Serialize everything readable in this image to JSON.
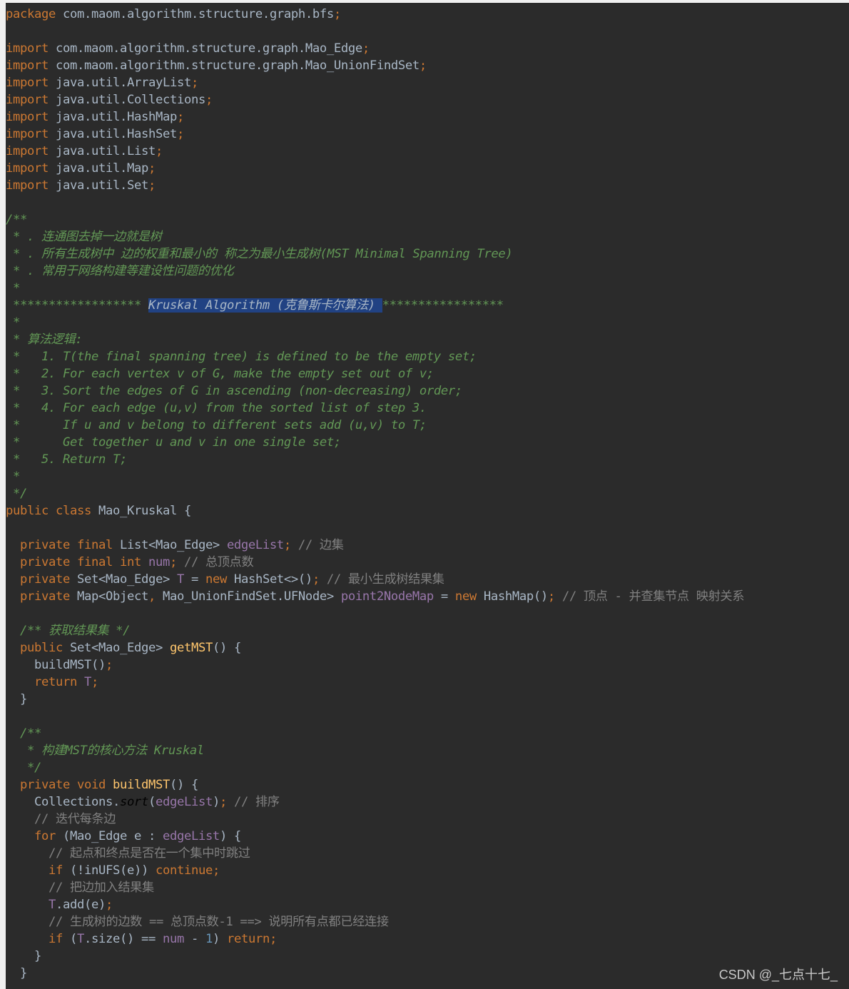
{
  "editor": {
    "background": "#2b2b2b",
    "selection_color": "#214283",
    "colors": {
      "keyword": "#cc7832",
      "plain": "#a9b7c6",
      "doc_comment": "#629755",
      "line_comment": "#808080",
      "field": "#9876aa",
      "method": "#ffc66d",
      "number": "#6897bb"
    }
  },
  "lines": [
    [
      [
        "kw",
        "package"
      ],
      [
        "pl",
        " com.maom.algorithm.structure.graph.bfs"
      ],
      [
        "kw",
        ";"
      ]
    ],
    [],
    [
      [
        "kw",
        "import"
      ],
      [
        "pl",
        " com.maom.algorithm.structure.graph.Mao_Edge"
      ],
      [
        "kw",
        ";"
      ]
    ],
    [
      [
        "kw",
        "import"
      ],
      [
        "pl",
        " com.maom.algorithm.structure.graph.Mao_UnionFindSet"
      ],
      [
        "kw",
        ";"
      ]
    ],
    [
      [
        "kw",
        "import"
      ],
      [
        "pl",
        " java.util.ArrayList"
      ],
      [
        "kw",
        ";"
      ]
    ],
    [
      [
        "kw",
        "import"
      ],
      [
        "pl",
        " java.util.Collections"
      ],
      [
        "kw",
        ";"
      ]
    ],
    [
      [
        "kw",
        "import"
      ],
      [
        "pl",
        " java.util.HashMap"
      ],
      [
        "kw",
        ";"
      ]
    ],
    [
      [
        "kw",
        "import"
      ],
      [
        "pl",
        " java.util.HashSet"
      ],
      [
        "kw",
        ";"
      ]
    ],
    [
      [
        "kw",
        "import"
      ],
      [
        "pl",
        " java.util.List"
      ],
      [
        "kw",
        ";"
      ]
    ],
    [
      [
        "kw",
        "import"
      ],
      [
        "pl",
        " java.util.Map"
      ],
      [
        "kw",
        ";"
      ]
    ],
    [
      [
        "kw",
        "import"
      ],
      [
        "pl",
        " java.util.Set"
      ],
      [
        "kw",
        ";"
      ]
    ],
    [],
    [
      [
        "cm",
        "/**"
      ]
    ],
    [
      [
        "cm",
        " * . 连通图去掉一边就是树"
      ]
    ],
    [
      [
        "cm",
        " * . 所有生成树中 边的权重和最小的 称之为最小生成树(MST Minimal Spanning Tree)"
      ]
    ],
    [
      [
        "cm",
        " * . 常用于网络构建等建设性问题的优化"
      ]
    ],
    [
      [
        "cm",
        " *"
      ]
    ],
    [
      [
        "cm",
        " ****************** "
      ],
      [
        "hl",
        "Kruskal Algorithm (克鲁斯卡尔算法) "
      ],
      [
        "cm",
        "*****************"
      ]
    ],
    [
      [
        "cm",
        " *"
      ]
    ],
    [
      [
        "cm",
        " * 算法逻辑:"
      ]
    ],
    [
      [
        "cm",
        " *   1. T(the final spanning tree) is defined to be the empty set;"
      ]
    ],
    [
      [
        "cm",
        " *   2. For each vertex v of G, make the empty set out of v;"
      ]
    ],
    [
      [
        "cm",
        " *   3. Sort the edges of G in ascending (non-decreasing) order;"
      ]
    ],
    [
      [
        "cm",
        " *   4. For each edge (u,v) from the sorted list of step 3."
      ]
    ],
    [
      [
        "cm",
        " *      If u and v belong to different sets add (u,v) to T;"
      ]
    ],
    [
      [
        "cm",
        " *      Get together u and v in one single set;"
      ]
    ],
    [
      [
        "cm",
        " *   5. Return T;"
      ]
    ],
    [
      [
        "cm",
        " *"
      ]
    ],
    [
      [
        "cm",
        " */"
      ]
    ],
    [
      [
        "kw",
        "public class"
      ],
      [
        "pl",
        " Mao_Kruskal {"
      ]
    ],
    [],
    [
      [
        "kw",
        "  private final"
      ],
      [
        "pl",
        " List<Mao_Edge> "
      ],
      [
        "fd",
        "edgeList"
      ],
      [
        "kw",
        ";"
      ],
      [
        "lc",
        " // 边集"
      ]
    ],
    [
      [
        "kw",
        "  private final int"
      ],
      [
        "fd",
        " num"
      ],
      [
        "kw",
        ";"
      ],
      [
        "lc",
        " // 总顶点数"
      ]
    ],
    [
      [
        "kw",
        "  private"
      ],
      [
        "pl",
        " Set<Mao_Edge> "
      ],
      [
        "fd",
        "T"
      ],
      [
        "pl",
        " = "
      ],
      [
        "kw",
        "new"
      ],
      [
        "pl",
        " HashSet<>()"
      ],
      [
        "kw",
        ";"
      ],
      [
        "lc",
        " // 最小生成树结果集"
      ]
    ],
    [
      [
        "kw",
        "  private"
      ],
      [
        "pl",
        " Map<Object"
      ],
      [
        "kw",
        ","
      ],
      [
        "pl",
        " Mao_UnionFindSet.UFNode> "
      ],
      [
        "fd",
        "point2NodeMap"
      ],
      [
        "pl",
        " = "
      ],
      [
        "kw",
        "new"
      ],
      [
        "pl",
        " HashMap()"
      ],
      [
        "kw",
        ";"
      ],
      [
        "lc",
        " // 顶点 - 并查集节点 映射关系"
      ]
    ],
    [],
    [
      [
        "cm",
        "  /** 获取结果集 */"
      ]
    ],
    [
      [
        "kw",
        "  public"
      ],
      [
        "pl",
        " Set<Mao_Edge> "
      ],
      [
        "fn",
        "getMST"
      ],
      [
        "pl",
        "() {"
      ]
    ],
    [
      [
        "pl",
        "    buildMST()"
      ],
      [
        "kw",
        ";"
      ]
    ],
    [
      [
        "kw",
        "    return"
      ],
      [
        "fd",
        " T"
      ],
      [
        "kw",
        ";"
      ]
    ],
    [
      [
        "pl",
        "  }"
      ]
    ],
    [],
    [
      [
        "cm",
        "  /**"
      ]
    ],
    [
      [
        "cm",
        "   * 构建MST的核心方法 Kruskal"
      ]
    ],
    [
      [
        "cm",
        "   */"
      ]
    ],
    [
      [
        "kw",
        "  private void"
      ],
      [
        "fn",
        " buildMST"
      ],
      [
        "pl",
        "() {"
      ]
    ],
    [
      [
        "pl",
        "    Collections."
      ],
      [
        "it",
        "sort"
      ],
      [
        "pl",
        "("
      ],
      [
        "fd",
        "edgeList"
      ],
      [
        "pl",
        ")"
      ],
      [
        "kw",
        ";"
      ],
      [
        "lc",
        " // 排序"
      ]
    ],
    [
      [
        "lc",
        "    // 迭代每条边"
      ]
    ],
    [
      [
        "kw",
        "    for"
      ],
      [
        "pl",
        " (Mao_Edge e : "
      ],
      [
        "fd",
        "edgeList"
      ],
      [
        "pl",
        ") {"
      ]
    ],
    [
      [
        "lc",
        "      // 起点和终点是否在一个集中时跳过"
      ]
    ],
    [
      [
        "kw",
        "      if"
      ],
      [
        "pl",
        " (!inUFS(e)) "
      ],
      [
        "kw",
        "continue;"
      ]
    ],
    [
      [
        "lc",
        "      // 把边加入结果集"
      ]
    ],
    [
      [
        "fd",
        "      T"
      ],
      [
        "pl",
        ".add(e)"
      ],
      [
        "kw",
        ";"
      ]
    ],
    [
      [
        "lc",
        "      // 生成树的边数 == 总顶点数-1 ==> 说明所有点都已经连接"
      ]
    ],
    [
      [
        "kw",
        "      if"
      ],
      [
        "pl",
        " ("
      ],
      [
        "fd",
        "T"
      ],
      [
        "pl",
        ".size() == "
      ],
      [
        "fd",
        "num"
      ],
      [
        "pl",
        " - "
      ],
      [
        "nm",
        "1"
      ],
      [
        "pl",
        ") "
      ],
      [
        "kw",
        "return;"
      ]
    ],
    [
      [
        "pl",
        "    }"
      ]
    ],
    [
      [
        "pl",
        "  }"
      ]
    ]
  ],
  "watermark": "CSDN @_七点十七_"
}
